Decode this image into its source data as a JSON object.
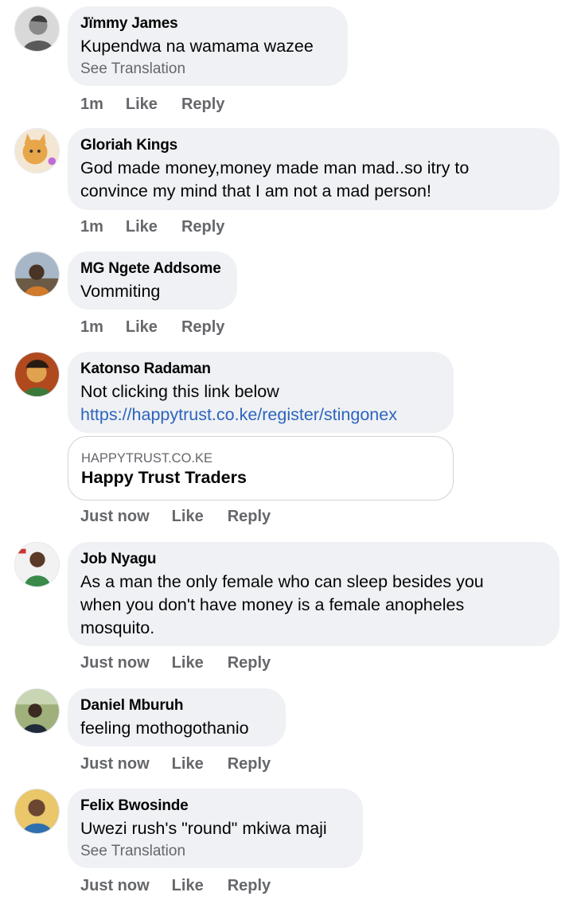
{
  "comments": [
    {
      "author": "Jïmmy James",
      "text": "Kupendwa na wamama wazee",
      "see_translation": "See Translation",
      "time": "1m",
      "like": "Like",
      "reply": "Reply",
      "avatar_icon": "profile-photo-man-icon"
    },
    {
      "author": "Gloriah Kings",
      "text_line1": "God made money,money made man mad..so itry to",
      "text_line2": "convince my mind that I am not a mad person!",
      "time": "1m",
      "like": "Like",
      "reply": "Reply",
      "avatar_icon": "profile-photo-cat-icon"
    },
    {
      "author": "MG Ngete Addsome",
      "text": "Vommiting",
      "time": "1m",
      "like": "Like",
      "reply": "Reply",
      "avatar_icon": "profile-photo-man-icon"
    },
    {
      "author": "Katonso Radaman",
      "text": "Not clicking this link below",
      "link": "https://happytrust.co.ke/register/stingonex",
      "preview_domain": "HAPPYTRUST.CO.KE",
      "preview_title": "Happy Trust Traders",
      "time": "Just now",
      "like": "Like",
      "reply": "Reply",
      "avatar_icon": "profile-photo-cartoon-icon"
    },
    {
      "author": "Job Nyagu",
      "text_line1": "As a man the only female who can sleep besides you",
      "text_line2": "when you don't have money is a female anopheles",
      "text_line3": "mosquito.",
      "time": "Just now",
      "like": "Like",
      "reply": "Reply",
      "avatar_icon": "profile-photo-man-icon"
    },
    {
      "author": "Daniel Mburuh",
      "text": "feeling mothogothanio",
      "time": "Just now",
      "like": "Like",
      "reply": "Reply",
      "avatar_icon": "profile-photo-man-icon"
    },
    {
      "author": "Felix Bwosinde",
      "text": "Uwezi rush's \"round\" mkiwa maji",
      "see_translation": "See Translation",
      "time": "Just now",
      "like": "Like",
      "reply": "Reply",
      "avatar_icon": "profile-photo-man-icon"
    }
  ],
  "colors": {
    "bubble": "#eff1f4",
    "secondary_text": "#65676b",
    "link": "#2d64bc"
  }
}
